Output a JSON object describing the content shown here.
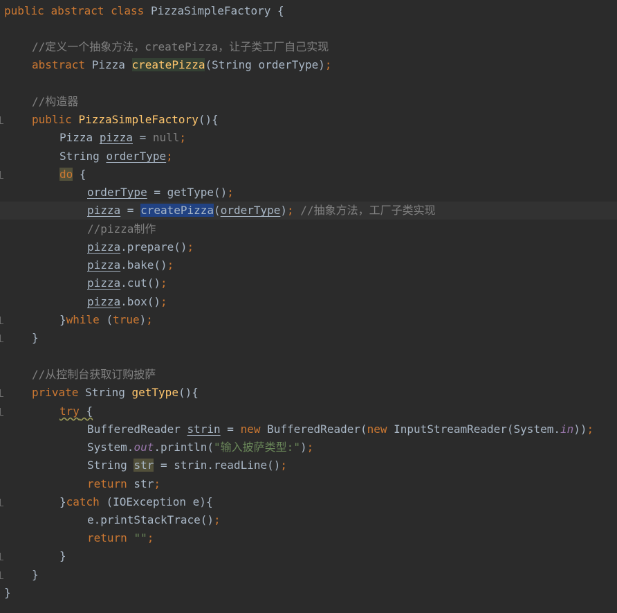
{
  "class_decl": {
    "kw1": "public",
    "kw2": "abstract",
    "kw3": "class",
    "name": "PizzaSimpleFactory",
    "brace": " {"
  },
  "comment_abstract": "//定义一个抽象方法，createPizza，让子类工厂自己实现",
  "abstract_decl": {
    "kw1": "abstract",
    "type": "Pizza",
    "name": "createPizza",
    "params": "(String orderType)",
    "semi": ";"
  },
  "comment_ctor": "//构造器",
  "ctor_decl": {
    "kw": "public",
    "name": "PizzaSimpleFactory",
    "rest": "(){"
  },
  "pizza_decl": {
    "type": "Pizza",
    "var": "pizza",
    "eq": " = ",
    "null": "null",
    "semi": ";"
  },
  "ordertype_decl": {
    "type": "String",
    "var": "orderType",
    "semi": ";"
  },
  "do_line": {
    "kw": "do",
    "rest": " {"
  },
  "assign_ordertype": {
    "var": "orderType",
    "rest": " = getType()",
    "semi": ";"
  },
  "assign_pizza": {
    "var": "pizza",
    "eq": " = ",
    "call": "createPizza",
    "open": "(",
    "arg": "orderType",
    "close": ")",
    "semi": ";",
    "comment": " //抽象方法，工厂子类实现"
  },
  "comment_make": "//pizza制作",
  "calls": [
    {
      "var": "pizza",
      "rest": ".prepare()",
      "semi": ";"
    },
    {
      "var": "pizza",
      "rest": ".bake()",
      "semi": ";"
    },
    {
      "var": "pizza",
      "rest": ".cut()",
      "semi": ";"
    },
    {
      "var": "pizza",
      "rest": ".box()",
      "semi": ";"
    }
  ],
  "while_line": {
    "brace": "}",
    "kw": "while",
    "open": " (",
    "true": "true",
    "close": ")",
    "semi": ";"
  },
  "close_brace": "}",
  "comment_gettype": "//从控制台获取订购披萨",
  "gettype_decl": {
    "kw": "private",
    "type": "String",
    "name": "getType",
    "rest": "(){"
  },
  "try_line": {
    "kw": "try",
    "rest": " {"
  },
  "reader_line": {
    "p1": "BufferedReader ",
    "var": "strin",
    "p2": " = ",
    "new1": "new",
    "p3": " BufferedReader(",
    "new2": "new",
    "p4": " InputStreamReader(System.",
    "in": "in",
    "p5": "))",
    "semi": ";"
  },
  "println_line": {
    "p1": "System.",
    "out": "out",
    "p2": ".println(",
    "str": "\"输入披萨类型:\"",
    "p3": ")",
    "semi": ";"
  },
  "readline_line": {
    "p1": "String ",
    "var": "str",
    "p2": " = strin.readLine()",
    "semi": ";"
  },
  "return_str": {
    "kw": "return",
    "rest": " str",
    "semi": ";"
  },
  "catch_line": {
    "brace": "}",
    "kw": "catch",
    "rest": " (IOException e){"
  },
  "print_trace": {
    "rest": "e.printStackTrace()",
    "semi": ";"
  },
  "return_empty": {
    "kw": "return",
    "str": "\"\"",
    "semi": ";"
  }
}
